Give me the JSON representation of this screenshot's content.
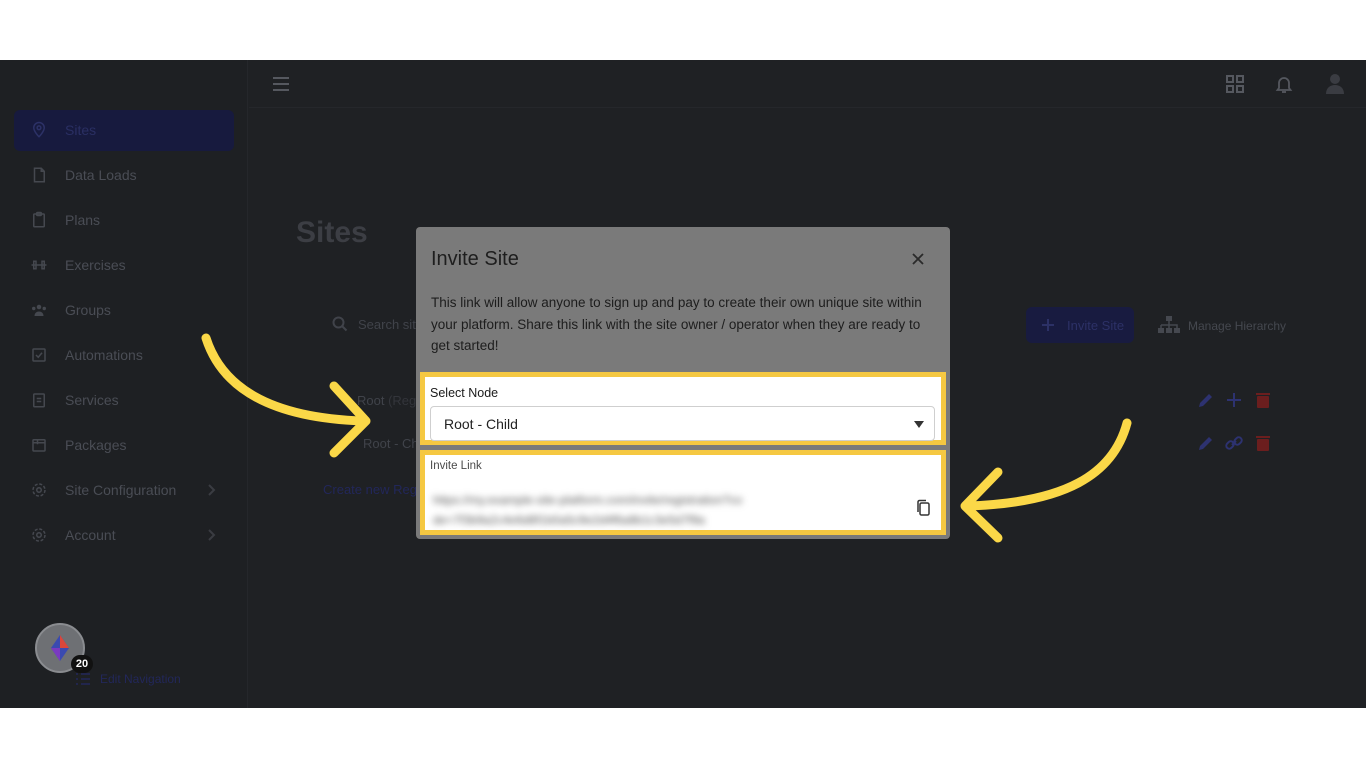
{
  "sidebar": {
    "items": [
      {
        "label": "Sites",
        "icon": "map-pin-icon",
        "active": true
      },
      {
        "label": "Data Loads",
        "icon": "document-icon"
      },
      {
        "label": "Plans",
        "icon": "clipboard-icon"
      },
      {
        "label": "Exercises",
        "icon": "dumbbell-icon"
      },
      {
        "label": "Groups",
        "icon": "users-icon"
      },
      {
        "label": "Automations",
        "icon": "checkbox-icon"
      },
      {
        "label": "Services",
        "icon": "clipboard-list-icon"
      },
      {
        "label": "Packages",
        "icon": "package-icon"
      },
      {
        "label": "Site Configuration",
        "icon": "gear-icon",
        "has_children": true
      },
      {
        "label": "Account",
        "icon": "account-gear-icon",
        "has_children": true
      }
    ],
    "notification_count": "20",
    "edit_navigation_label": "Edit Navigation"
  },
  "page": {
    "title": "Sites",
    "search_placeholder": "Search site",
    "invite_site_label": "Invite Site",
    "manage_hierarchy_label": "Manage Hierarchy",
    "rows": [
      {
        "name": "Root",
        "suffix": "(Regi"
      },
      {
        "name": "Root - Ch",
        "suffix": ""
      }
    ],
    "create_new_label": "Create new Regi"
  },
  "modal": {
    "title": "Invite Site",
    "description": "This link will allow anyone to sign up and pay to create their own unique site within your platform. Share this link with the site owner / operator when they are ready to get started!",
    "select_node_label": "Select Node",
    "select_node_value": "Root - Child",
    "invite_link_label": "Invite Link",
    "invite_link_value": "https://my.example-site-platform.com/invite/registration?code=7f3b9a2c4e6d8f1b0a5c9e2d4f6a8b1c3e5d7f9a"
  },
  "colors": {
    "highlight": "#f5c842",
    "arrow": "#fbd848",
    "backdrop": "#1f2124"
  }
}
